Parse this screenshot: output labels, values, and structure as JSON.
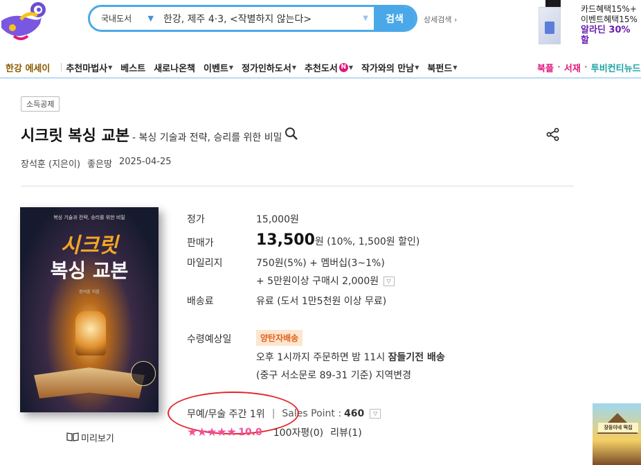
{
  "search": {
    "category": "국내도서",
    "query": "한강, 제주 4·3, <작별하지 않는다>",
    "button": "검색",
    "advanced": "상세검색 ›"
  },
  "promo": {
    "line1": "카드혜택15%+",
    "line2": "이벤트혜택15%",
    "line3": "알라딘 30% 할"
  },
  "nav": {
    "items": [
      {
        "label": "한강 에세이",
        "dropdown": false
      },
      {
        "label": "추천마법사",
        "dropdown": true
      },
      {
        "label": "베스트",
        "dropdown": false
      },
      {
        "label": "새로나온책",
        "dropdown": false
      },
      {
        "label": "이벤트",
        "dropdown": true
      },
      {
        "label": "정가인하도서",
        "dropdown": true
      },
      {
        "label": "추천도서",
        "dropdown": true,
        "badge": "N"
      },
      {
        "label": "작가와의 만남",
        "dropdown": true
      },
      {
        "label": "북펀드",
        "dropdown": true
      }
    ],
    "right": [
      "북플",
      "서재",
      "투비컨티뉴드"
    ]
  },
  "book": {
    "tag": "소득공제",
    "title": "시크릿 복싱 교본",
    "subtitle": "- 복싱 기술과 전략, 승리를 위한 비밀",
    "author": "장석훈 (지은이)",
    "publisher": "좋은땅",
    "date": "2025-04-25",
    "preview": "미리보기",
    "cover": {
      "top": "복싱 기술과 전략, 승리를 위한 비밀",
      "title1": "시크릿",
      "title2": "복싱 교본",
      "author": "장석훈 지음"
    }
  },
  "price": {
    "list_label": "정가",
    "list_value": "15,000원",
    "sale_label": "판매가",
    "sale_value": "13,500",
    "sale_unit": "원",
    "sale_discount": "(10%, 1,500원 할인)",
    "mileage_label": "마일리지",
    "mileage_value": "750원(5%) + 멤버십(3~1%)",
    "mileage_extra": "+ 5만원이상 구매시 2,000원",
    "shipping_label": "배송료",
    "shipping_value": "유료 (도서 1만5천원 이상 무료)",
    "receive_label": "수령예상일",
    "receive_badge": "양탄자배송",
    "receive_line1_pre": "오후 1시까지 주문하면 밤 11시 ",
    "receive_line1_bold": "잠들기전 배송",
    "receive_line2": "(중구 서소문로 89-31 기준) 지역변경"
  },
  "rank": {
    "text": "무예/무술 주간 1위",
    "sales_label": "Sales Point :",
    "sales_value": "460"
  },
  "rating": {
    "stars": 5,
    "score": "10.0",
    "reviews_count": "100자평(0)",
    "reviews": "리뷰(1)"
  },
  "side_ad": {
    "text": "장등이네 떡집"
  },
  "colors": {
    "accent": "#4aa8e8",
    "pink": "#e0177b",
    "teal": "#1aa3a3",
    "star": "#f0509a",
    "annotation": "#e3262b"
  }
}
